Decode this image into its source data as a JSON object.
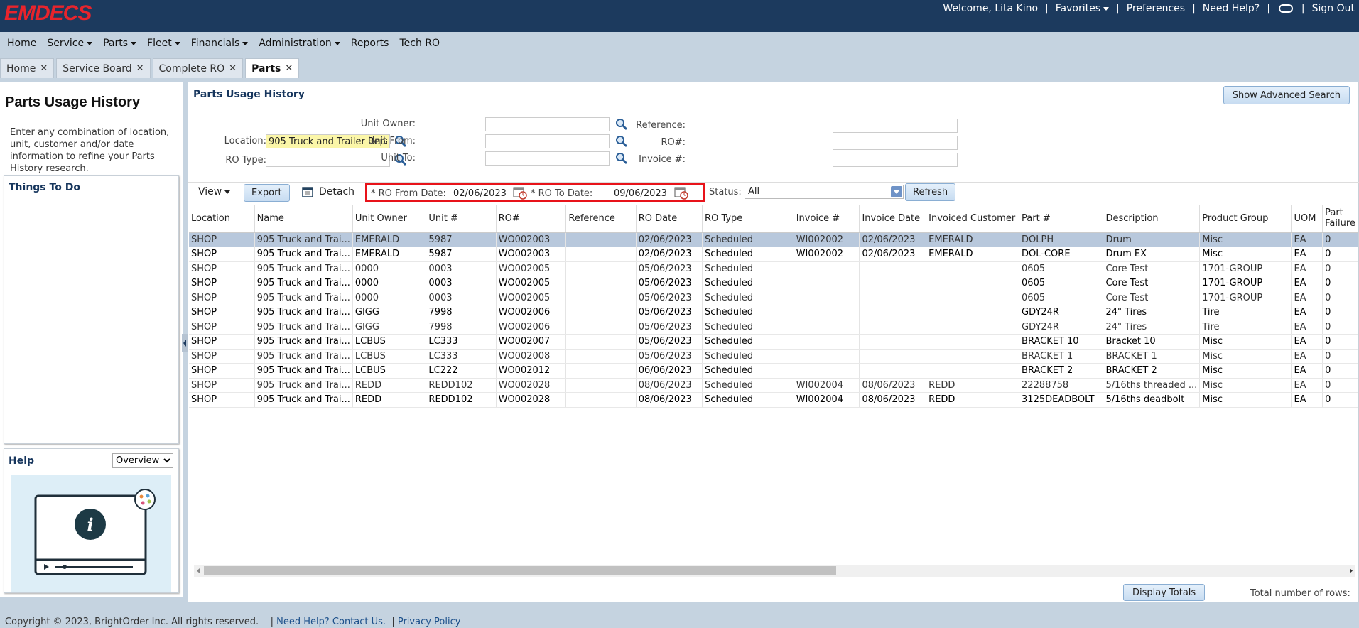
{
  "header": {
    "logo": "EMDECS",
    "welcome": "Welcome, Lita Kino",
    "favorites": "Favorites",
    "preferences": "Preferences",
    "need_help": "Need Help?",
    "sign_out": "Sign Out"
  },
  "menu": [
    "Home",
    "Service",
    "Parts",
    "Fleet",
    "Financials",
    "Administration",
    "Reports",
    "Tech RO"
  ],
  "tabs": [
    "Home",
    "Service Board",
    "Complete RO",
    "Parts"
  ],
  "left": {
    "title": "Parts Usage History",
    "intro": "Enter any combination of location, unit, customer and/or date information to refine your Parts History research.",
    "todo_title": "Things To Do",
    "help_title": "Help",
    "help_select": "Overview"
  },
  "main": {
    "title": "Parts Usage History",
    "adv_search": "Show Advanced Search",
    "filters": {
      "location_label": "Location:",
      "location_value": "905 Truck and Trailer Repair",
      "ro_type_label": "RO Type:",
      "unit_owner_label": "Unit Owner:",
      "unit_from_label": "Unit From:",
      "unit_to_label": "Unit To:",
      "reference_label": "Reference:",
      "ro_num_label": "RO#:",
      "invoice_label": "Invoice #:"
    },
    "toolbar": {
      "view": "View",
      "export": "Export",
      "detach": "Detach",
      "from_label": "* RO From Date:",
      "from_value": "02/06/2023",
      "to_label": "* RO To Date:",
      "to_value": "09/06/2023",
      "status_label": "Status:",
      "status_value": "All",
      "refresh": "Refresh"
    },
    "columns": [
      "Location",
      "Name",
      "Unit Owner",
      "Unit #",
      "RO#",
      "Reference",
      "RO Date",
      "RO Type",
      "Invoice #",
      "Invoice Date",
      "Invoiced Customer",
      "Part #",
      "Description",
      "Product Group",
      "UOM",
      "Part Failure"
    ],
    "rows": [
      [
        "SHOP",
        "905 Truck and Trai...",
        "EMERALD",
        "5987",
        "WO002003",
        "",
        "02/06/2023",
        "Scheduled",
        "WI002002",
        "02/06/2023",
        "EMERALD",
        "DOLPH",
        "Drum",
        "Misc",
        "EA",
        "0"
      ],
      [
        "SHOP",
        "905 Truck and Trai...",
        "EMERALD",
        "5987",
        "WO002003",
        "",
        "02/06/2023",
        "Scheduled",
        "WI002002",
        "02/06/2023",
        "EMERALD",
        "DOL-CORE",
        "Drum EX",
        "Misc",
        "EA",
        "0"
      ],
      [
        "SHOP",
        "905 Truck and Trai...",
        "0000",
        "0003",
        "WO002005",
        "",
        "05/06/2023",
        "Scheduled",
        "",
        "",
        "",
        "0605",
        "Core Test",
        "1701-GROUP",
        "EA",
        "0"
      ],
      [
        "SHOP",
        "905 Truck and Trai...",
        "0000",
        "0003",
        "WO002005",
        "",
        "05/06/2023",
        "Scheduled",
        "",
        "",
        "",
        "0605",
        "Core Test",
        "1701-GROUP",
        "EA",
        "0"
      ],
      [
        "SHOP",
        "905 Truck and Trai...",
        "0000",
        "0003",
        "WO002005",
        "",
        "05/06/2023",
        "Scheduled",
        "",
        "",
        "",
        "0605",
        "Core Test",
        "1701-GROUP",
        "EA",
        "0"
      ],
      [
        "SHOP",
        "905 Truck and Trai...",
        "GIGG",
        "7998",
        "WO002006",
        "",
        "05/06/2023",
        "Scheduled",
        "",
        "",
        "",
        "GDY24R",
        "24\" Tires",
        "Tire",
        "EA",
        "0"
      ],
      [
        "SHOP",
        "905 Truck and Trai...",
        "GIGG",
        "7998",
        "WO002006",
        "",
        "05/06/2023",
        "Scheduled",
        "",
        "",
        "",
        "GDY24R",
        "24\" Tires",
        "Tire",
        "EA",
        "0"
      ],
      [
        "SHOP",
        "905 Truck and Trai...",
        "LCBUS",
        "LC333",
        "WO002007",
        "",
        "05/06/2023",
        "Scheduled",
        "",
        "",
        "",
        "BRACKET 10",
        "Bracket 10",
        "Misc",
        "EA",
        "0"
      ],
      [
        "SHOP",
        "905 Truck and Trai...",
        "LCBUS",
        "LC333",
        "WO002008",
        "",
        "05/06/2023",
        "Scheduled",
        "",
        "",
        "",
        "BRACKET 1",
        "BRACKET 1",
        "Misc",
        "EA",
        "0"
      ],
      [
        "SHOP",
        "905 Truck and Trai...",
        "LCBUS",
        "LC222",
        "WO002012",
        "",
        "06/06/2023",
        "Scheduled",
        "",
        "",
        "",
        "BRACKET 2",
        "BRACKET 2",
        "Misc",
        "EA",
        "0"
      ],
      [
        "SHOP",
        "905 Truck and Trai...",
        "REDD",
        "REDD102",
        "WO002028",
        "",
        "08/06/2023",
        "Scheduled",
        "WI002004",
        "08/06/2023",
        "REDD",
        "22288758",
        "5/16ths threaded ...",
        "Misc",
        "EA",
        "0"
      ],
      [
        "SHOP",
        "905 Truck and Trai...",
        "REDD",
        "REDD102",
        "WO002028",
        "",
        "08/06/2023",
        "Scheduled",
        "WI002004",
        "08/06/2023",
        "REDD",
        "3125DEADBOLT",
        "5/16ths deadbolt",
        "Misc",
        "EA",
        "0"
      ]
    ],
    "display_totals": "Display Totals",
    "total_rows_label": "Total number of rows:"
  },
  "footer": {
    "copyright": "Copyright © 2023, BrightOrder Inc. All rights reserved.",
    "help_link": "Need Help? Contact Us.",
    "privacy": "Privacy Policy"
  }
}
